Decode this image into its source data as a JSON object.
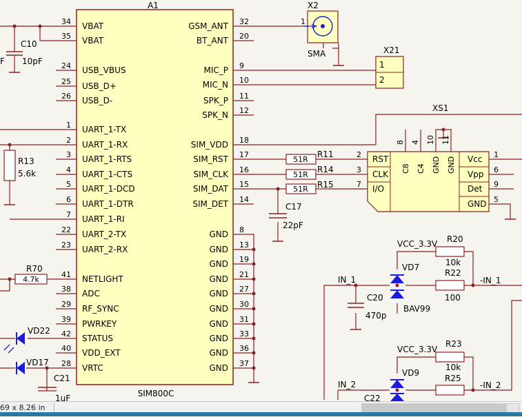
{
  "colors": {
    "wire": "#8b2020",
    "body": "#ffffc0",
    "body_stroke": "#8b2020",
    "text": "#141414",
    "diode": "#1a1ae0",
    "pin": "#1a1ae0",
    "junction": "#8b2020"
  },
  "status": {
    "dimension": "69 x 8.26 in"
  },
  "ic": {
    "refdes": "A1",
    "value": "SIM800C",
    "left_pins": [
      {
        "num": "34",
        "name": "VBAT"
      },
      {
        "num": "35",
        "name": "VBAT"
      },
      {
        "num": "24",
        "name": "USB_VBUS"
      },
      {
        "num": "25",
        "name": "USB_D+"
      },
      {
        "num": "26",
        "name": "USB_D-"
      },
      {
        "num": "1",
        "name": "UART_1-TX"
      },
      {
        "num": "2",
        "name": "UART_1-RX"
      },
      {
        "num": "3",
        "name": "UART_1-RTS"
      },
      {
        "num": "4",
        "name": "UART_1-CTS"
      },
      {
        "num": "5",
        "name": "UART_1-DCD"
      },
      {
        "num": "6",
        "name": "UART_1-DTR"
      },
      {
        "num": "7",
        "name": "UART_1-RI"
      },
      {
        "num": "22",
        "name": "UART_2-TX"
      },
      {
        "num": "23",
        "name": "UART_2-RX"
      },
      {
        "num": "41",
        "name": "NETLIGHT"
      },
      {
        "num": "38",
        "name": "ADC"
      },
      {
        "num": "29",
        "name": "RF_SYNC"
      },
      {
        "num": "39",
        "name": "PWRKEY"
      },
      {
        "num": "42",
        "name": "STATUS"
      },
      {
        "num": "40",
        "name": "VDD_EXT"
      },
      {
        "num": "28",
        "name": "VRTC"
      }
    ],
    "right_pins": [
      {
        "num": "32",
        "name": "GSM_ANT"
      },
      {
        "num": "20",
        "name": "BT_ANT"
      },
      {
        "num": "9",
        "name": "MIC_P"
      },
      {
        "num": "10",
        "name": "MIC_N"
      },
      {
        "num": "11",
        "name": "SPK_P"
      },
      {
        "num": "12",
        "name": "SPK_N"
      },
      {
        "num": "18",
        "name": "SIM_VDD"
      },
      {
        "num": "17",
        "name": "SIM_RST"
      },
      {
        "num": "16",
        "name": "SIM_CLK"
      },
      {
        "num": "15",
        "name": "SIM_DAT"
      },
      {
        "num": "14",
        "name": "SIM_DET"
      },
      {
        "num": "8",
        "name": "GND"
      },
      {
        "num": "13",
        "name": "GND"
      },
      {
        "num": "19",
        "name": "GND"
      },
      {
        "num": "21",
        "name": "GND"
      },
      {
        "num": "27",
        "name": "GND"
      },
      {
        "num": "30",
        "name": "GND"
      },
      {
        "num": "31",
        "name": "GND"
      },
      {
        "num": "33",
        "name": "GND"
      },
      {
        "num": "36",
        "name": "GND"
      },
      {
        "num": "37",
        "name": "GND"
      }
    ]
  },
  "antenna": {
    "refdes": "X2",
    "value": "SMA",
    "pin": "1"
  },
  "header": {
    "refdes": "X21",
    "pins": [
      "1",
      "2"
    ]
  },
  "sim": {
    "refdes": "XS1",
    "left_pins": [
      {
        "num": "2",
        "name": "RST"
      },
      {
        "num": "3",
        "name": "CLK"
      },
      {
        "num": "7",
        "name": "I/O"
      }
    ],
    "top_pins": [
      {
        "num": "8",
        "name": "C8"
      },
      {
        "num": "4",
        "name": "C4"
      },
      {
        "num": "10",
        "name": "GND"
      },
      {
        "num": "11",
        "name": "GND"
      }
    ],
    "right_pins": [
      {
        "num": "1",
        "name": "Vcc"
      },
      {
        "num": "6",
        "name": "Vpp"
      },
      {
        "num": "9",
        "name": "Det"
      },
      {
        "num": "5",
        "name": "GND"
      }
    ]
  },
  "resistors": {
    "r11": {
      "refdes": "R11",
      "value": "51R"
    },
    "r14": {
      "refdes": "R14",
      "value": "51R"
    },
    "r15": {
      "refdes": "R15",
      "value": "51R"
    },
    "r13": {
      "refdes": "R13",
      "value": "5.6k"
    },
    "r70": {
      "refdes": "R70",
      "value": "4.7k"
    },
    "r20": {
      "refdes": "R20",
      "value": "10k"
    },
    "r22": {
      "refdes": "R22",
      "value": "100"
    },
    "r23": {
      "refdes": "R23",
      "value": "10k"
    },
    "r25": {
      "refdes": "R25",
      "value": "100"
    }
  },
  "capacitors": {
    "c10": {
      "refdes": "C10",
      "value": "10pF"
    },
    "c17": {
      "refdes": "C17",
      "value": "22pF"
    },
    "c20": {
      "refdes": "C20",
      "value": "470p"
    },
    "c21": {
      "refdes": "C21",
      "value": "1uF"
    },
    "c22": {
      "refdes": "C22"
    }
  },
  "diodes": {
    "vd7": {
      "refdes": "VD7",
      "value": "BAV99"
    },
    "vd9": {
      "refdes": "VD9"
    },
    "vd22": {
      "refdes": "VD22"
    },
    "vd17": {
      "refdes": "VD17"
    }
  },
  "nets": {
    "vcc1": "VCC_3.3V",
    "vcc2": "VCC_3.3V",
    "in1": "IN_1",
    "in1_out": "-IN_1",
    "in2": "IN_2",
    "in2_out": "-IN_2"
  },
  "fragments": {
    "f_left": "F"
  }
}
